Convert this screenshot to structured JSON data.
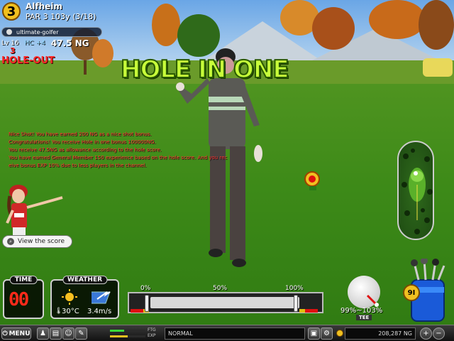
{
  "hole": {
    "number": "3",
    "course": "Alfheim",
    "info": "PAR 3  103y  (3/18)"
  },
  "player": {
    "name": "ultimate-golfer",
    "level": "Lv 16",
    "hc": "HC +4",
    "ng": "47.5 NG",
    "stroke_count": "3",
    "holeout_label": "HOLE-OUT"
  },
  "banner": "HOLE IN ONE",
  "chat_lines": [
    "Nice Shot! You have earned  200 NG as a nice shot bonus.",
    "Congratulations! You receive Hole in one bonus  100000NG.",
    "You receive  47.5NG as allowance according to the hole score.",
    "You have earned General Member 150 experience based on the hole score. And you rec",
    "eive bonus EXP  10% due to less players in the channel."
  ],
  "view_score_label": "View the score",
  "time": {
    "title": "TIME",
    "value": "00"
  },
  "weather": {
    "title": "WEATHER",
    "temperature": "30°C",
    "wind": "3.4m/s"
  },
  "power": {
    "label_0": "0%",
    "label_50": "50%",
    "label_100": "100%"
  },
  "impact": {
    "accuracy": "99%~103%",
    "tee_label": "TEE"
  },
  "club": {
    "value": "9I"
  },
  "bottom_bar": {
    "menu_label": "MENU",
    "ftg_label": "FTG",
    "exp_label": "EXP",
    "ftg_level": 0.4,
    "exp_level": 0.5,
    "mode": "NORMAL",
    "money": "208,287 NG"
  },
  "colors": {
    "banner": "#c8ff3a",
    "chat": "#ff3030",
    "holeout": "#ff2a2a",
    "time_digits": "#ff2a1a"
  }
}
